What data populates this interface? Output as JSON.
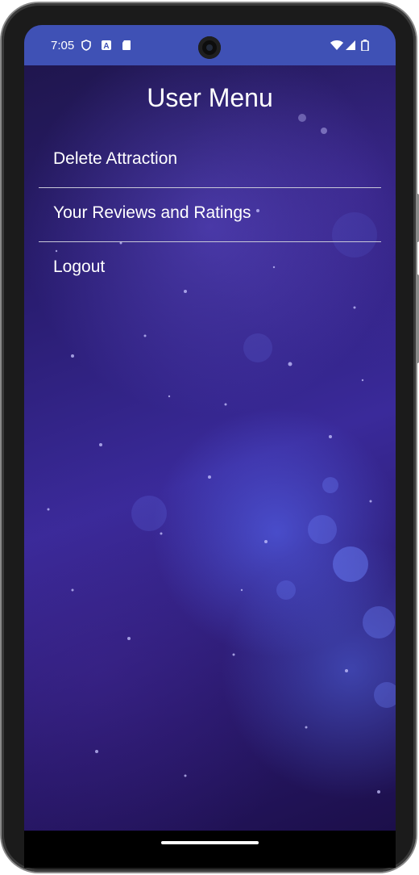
{
  "status_bar": {
    "time": "7:05",
    "color": "#3f51b5",
    "left_icons": [
      "shield-icon",
      "a-notification-icon",
      "sd-card-icon"
    ],
    "right_icons": [
      "wifi-icon",
      "cellular-signal-icon",
      "battery-icon"
    ]
  },
  "page": {
    "title": "User Menu",
    "background": "space-nebula-image"
  },
  "menu": {
    "items": [
      {
        "label": "Delete Attraction"
      },
      {
        "label": "Your Reviews and Ratings"
      },
      {
        "label": "Logout"
      }
    ]
  }
}
